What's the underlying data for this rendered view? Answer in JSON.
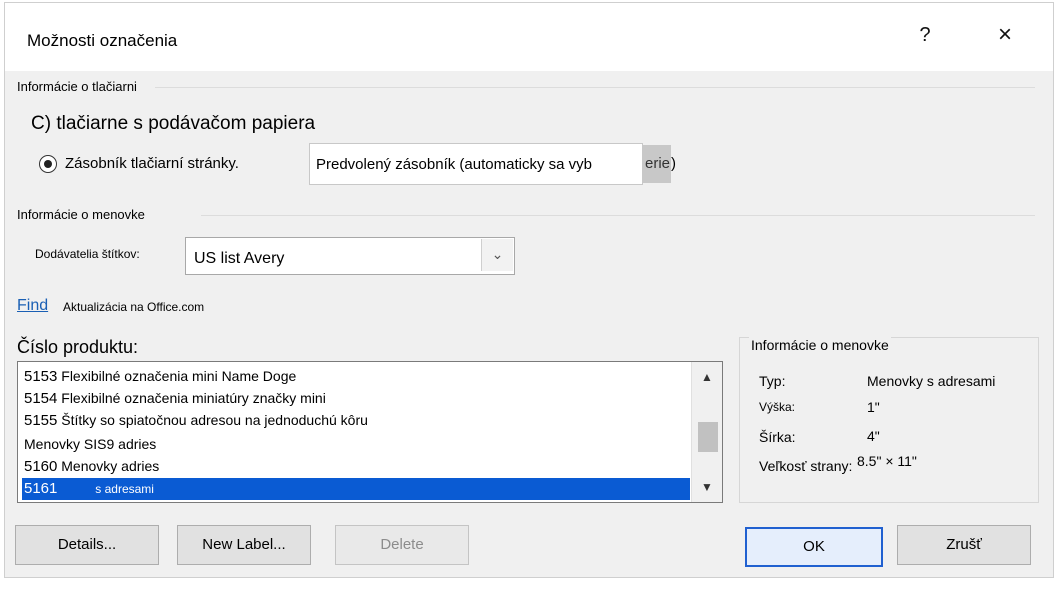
{
  "window": {
    "title": "Možnosti označenia",
    "help": "?",
    "close": "×"
  },
  "printer": {
    "section": "Informácie o tlačiarni",
    "type": "C) tlačiarne s podávačom papiera",
    "tray_label": "Zásobník tlačiarní stránky.",
    "tray_value": "Predvolený zásobník (automaticky sa vyb",
    "tray_value_hidden": "erie",
    "tray_tail": ")"
  },
  "label_info": {
    "section": "Informácie o menovke",
    "vendor_label": "Dodávatelia štítkov:",
    "vendor_value": "US list Avery",
    "find_link": "Find",
    "update_text": "Aktualizácia na Office.com"
  },
  "products": {
    "header": "Číslo produktu:",
    "items": [
      {
        "num": "5153",
        "text": "Flexibilné označenia mini Name Doge"
      },
      {
        "num": "5154",
        "text": "Flexibilné označenia miniatúry značky mini"
      },
      {
        "num": "5155",
        "text": "Štítky so spiatočnou adresou na jednoduchú kôru"
      },
      {
        "num": "",
        "text": "Menovky SIS9 adries"
      },
      {
        "num": "5160",
        "text": "Menovky adries"
      },
      {
        "num": "5161",
        "text": "s adresami"
      }
    ]
  },
  "details": {
    "title": "Informácie o menovke",
    "type_label": "Typ:",
    "type_value": "Menovky s adresami",
    "height_label": "Výška:",
    "height_value": "1\"",
    "width_label": "Šírka:",
    "width_value": "4\"",
    "pagesize_label": "Veľkosť strany:",
    "pagesize_value": "8.5\" × 11\""
  },
  "buttons": {
    "details": "Details...",
    "new_label": "New Label...",
    "delete": "Delete",
    "ok": "OK",
    "cancel": "Zrušť"
  }
}
